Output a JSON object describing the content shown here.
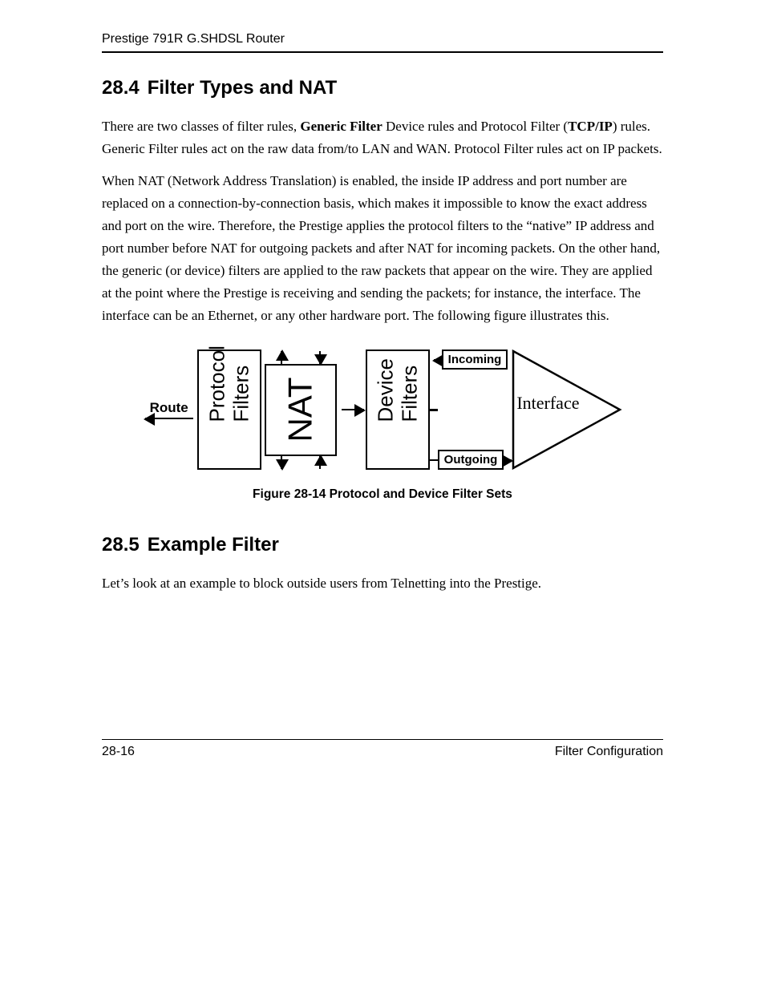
{
  "header": {
    "title": "Prestige 791R G.SHDSL Router"
  },
  "section1": {
    "number": "28.4",
    "title": "Filter Types and NAT",
    "p1_a": "There are two classes of filter rules, ",
    "p1_b_bold": "Generic Filter",
    "p1_c": " Device rules and Protocol Filter (",
    "p1_d_bold": "TCP/IP",
    "p1_e": ") rules. Generic Filter rules act on the raw data from/to LAN and WAN. Protocol Filter rules act on IP packets.",
    "p2": "When NAT  (Network Address Translation) is enabled, the inside IP address and port number are replaced on a connection-by-connection basis, which makes it impossible to know the exact address and port on the wire. Therefore, the Prestige applies the protocol filters to the “native” IP address and port number before NAT for outgoing packets and after NAT for incoming packets. On the other hand, the generic (or device) filters are applied to the raw packets that appear on the wire. They are applied at the point where the Prestige is receiving and sending the packets; for instance, the interface. The interface can be an Ethernet, or any other hardware port. The following figure illustrates this."
  },
  "figure": {
    "route": "Route",
    "protocol_filters": "Protocol Filters",
    "nat": "NAT",
    "device_filters": "Device Filters",
    "incoming": "Incoming",
    "outgoing": "Outgoing",
    "interface": "Interface",
    "caption": "Figure 28-14 Protocol and Device Filter Sets"
  },
  "section2": {
    "number": "28.5",
    "title": "Example Filter",
    "p1": "Let’s look at an example to block outside users from Telnetting into the Prestige."
  },
  "footer": {
    "left": "28-16",
    "right": "Filter Configuration"
  }
}
